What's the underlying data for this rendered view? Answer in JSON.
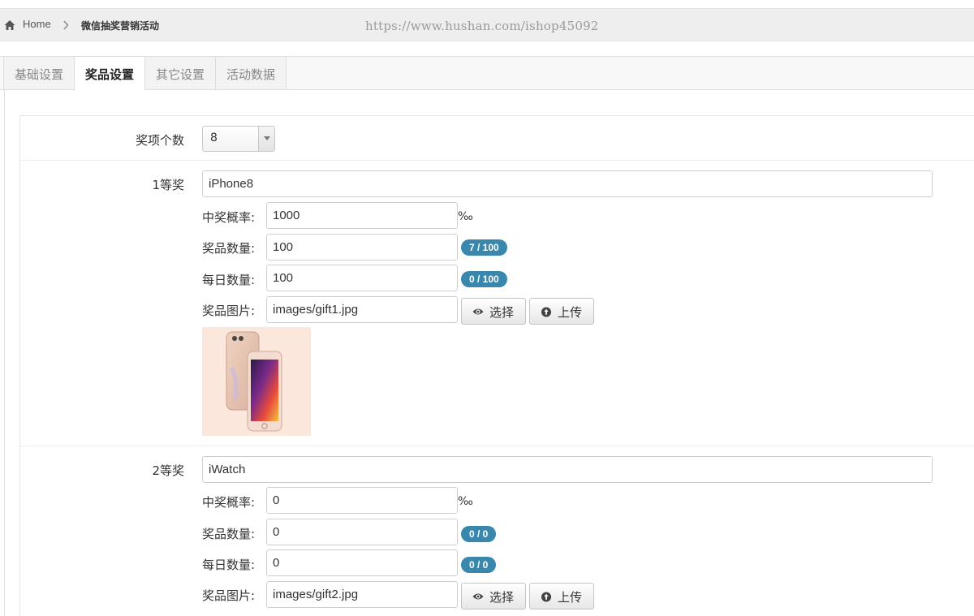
{
  "breadcrumb": {
    "home_label": "Home",
    "current_label": "微信抽奖营销活动"
  },
  "watermark": "https://www.hushan.com/ishop45092",
  "tabs": [
    {
      "label": "基础设置",
      "active": false
    },
    {
      "label": "奖品设置",
      "active": true
    },
    {
      "label": "其它设置",
      "active": false
    },
    {
      "label": "活动数据",
      "active": false
    }
  ],
  "prize_count": {
    "label": "奖项个数",
    "value": "8"
  },
  "field_labels": {
    "probability": "中奖概率:",
    "quantity": "奖品数量:",
    "daily": "每日数量:",
    "image": "奖品图片:",
    "permille": "‰"
  },
  "buttons": {
    "choose": "选择",
    "upload": "上传"
  },
  "prizes": [
    {
      "title": "1等奖",
      "name": "iPhone8",
      "probability": "1000",
      "quantity": "100",
      "quantity_badge": "7 / 100",
      "daily": "100",
      "daily_badge": "0 / 100",
      "image": "images/gift1.jpg"
    },
    {
      "title": "2等奖",
      "name": "iWatch",
      "probability": "0",
      "quantity": "0",
      "quantity_badge": "0 / 0",
      "daily": "0",
      "daily_badge": "0 / 0",
      "image": "images/gift2.jpg"
    }
  ],
  "colors": {
    "badge": "#3a87ad",
    "breadcrumb_bg": "#eeeeee",
    "tab_bg": "#f3f3f3"
  }
}
